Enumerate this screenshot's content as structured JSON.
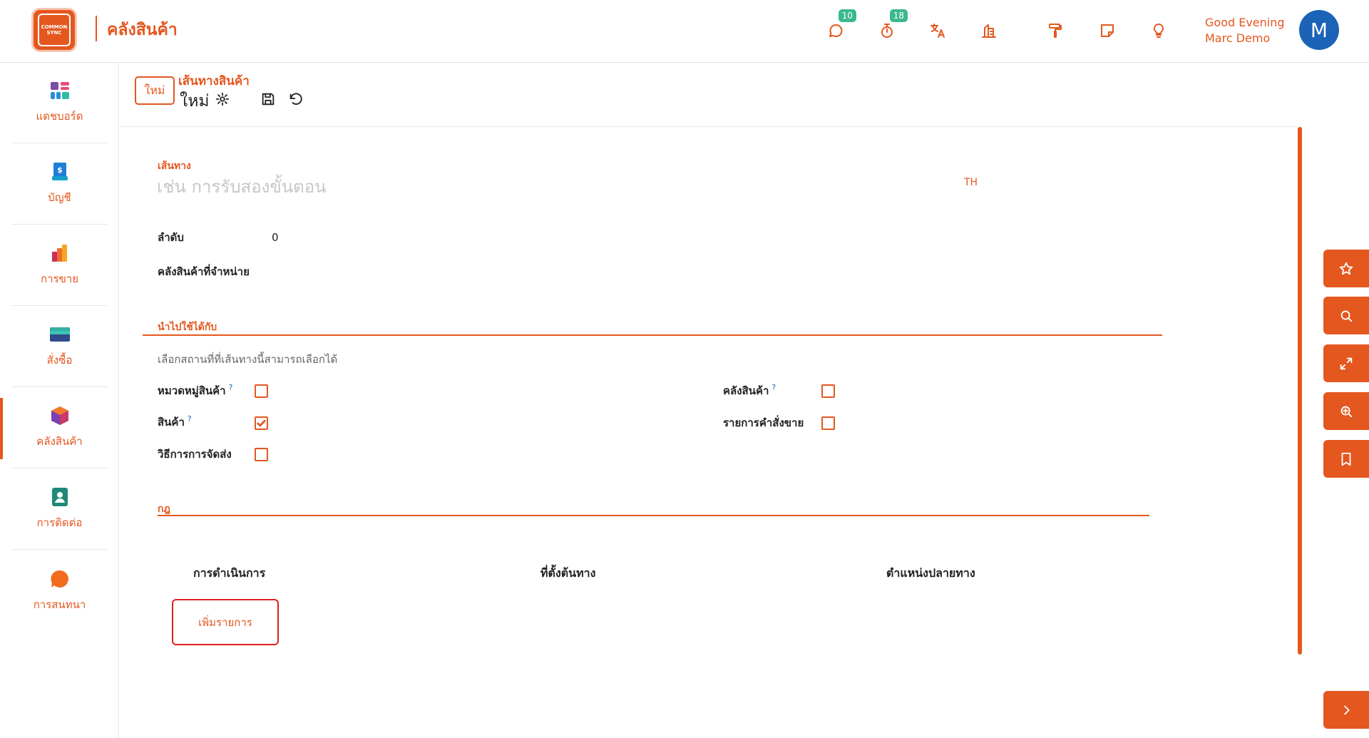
{
  "app": {
    "logo_text": "COMMON SYNC",
    "title": "คลังสินค้า"
  },
  "topbar": {
    "chat_badge": "10",
    "timer_badge": "18",
    "greeting": "Good Evening",
    "user_name": "Marc Demo",
    "avatar_initial": "M"
  },
  "sidebar": {
    "items": [
      {
        "label": "แดชบอร์ด",
        "icon": "dashboard-icon"
      },
      {
        "label": "บัญชี",
        "icon": "invoice-icon"
      },
      {
        "label": "การขาย",
        "icon": "sales-chart-icon"
      },
      {
        "label": "สั่งซื้อ",
        "icon": "card-icon"
      },
      {
        "label": "คลังสินค้า",
        "icon": "box-icon"
      },
      {
        "label": "การติดต่อ",
        "icon": "contact-icon"
      },
      {
        "label": "การสนทนา",
        "icon": "chat-bubble-icon"
      }
    ],
    "active_index": 4
  },
  "header": {
    "new_button": "ใหม่",
    "breadcrumb": "เส้นทางสินค้า",
    "record_title": "ใหม่"
  },
  "form": {
    "route_label": "เส้นทาง",
    "route_placeholder": "เช่น การรับสองขั้นตอน",
    "lang_tag": "TH",
    "sequence_label": "ลำดับ",
    "sequence_value": "0",
    "warehouse_label": "คลังสินค้าที่จำหน่าย",
    "applicable_section": "นำไปใช้ได้กับ",
    "applicable_hint": "เลือกสถานที่ที่เส้นทางนี้สามารถเลือกได้",
    "options_left": [
      {
        "label": "หมวดหมู่สินค้า",
        "help": "?",
        "checked": false
      },
      {
        "label": "สินค้า",
        "help": "?",
        "checked": true
      },
      {
        "label": "วิธีการการจัดส่ง",
        "help": "",
        "checked": false
      }
    ],
    "options_right": [
      {
        "label": "คลังสินค้า",
        "help": "?",
        "checked": false
      },
      {
        "label": "รายการคำสั่งขาย",
        "help": "",
        "checked": false
      }
    ],
    "rules_section": "กฎ",
    "rules_columns": [
      "การดำเนินการ",
      "ที่ตั้งต้นทาง",
      "ตำแหน่งปลายทาง"
    ],
    "add_line": "เพิ่มรายการ"
  },
  "colors": {
    "accent": "#e4571f",
    "success_badge": "#3bb98c",
    "avatar": "#1b63b6"
  }
}
